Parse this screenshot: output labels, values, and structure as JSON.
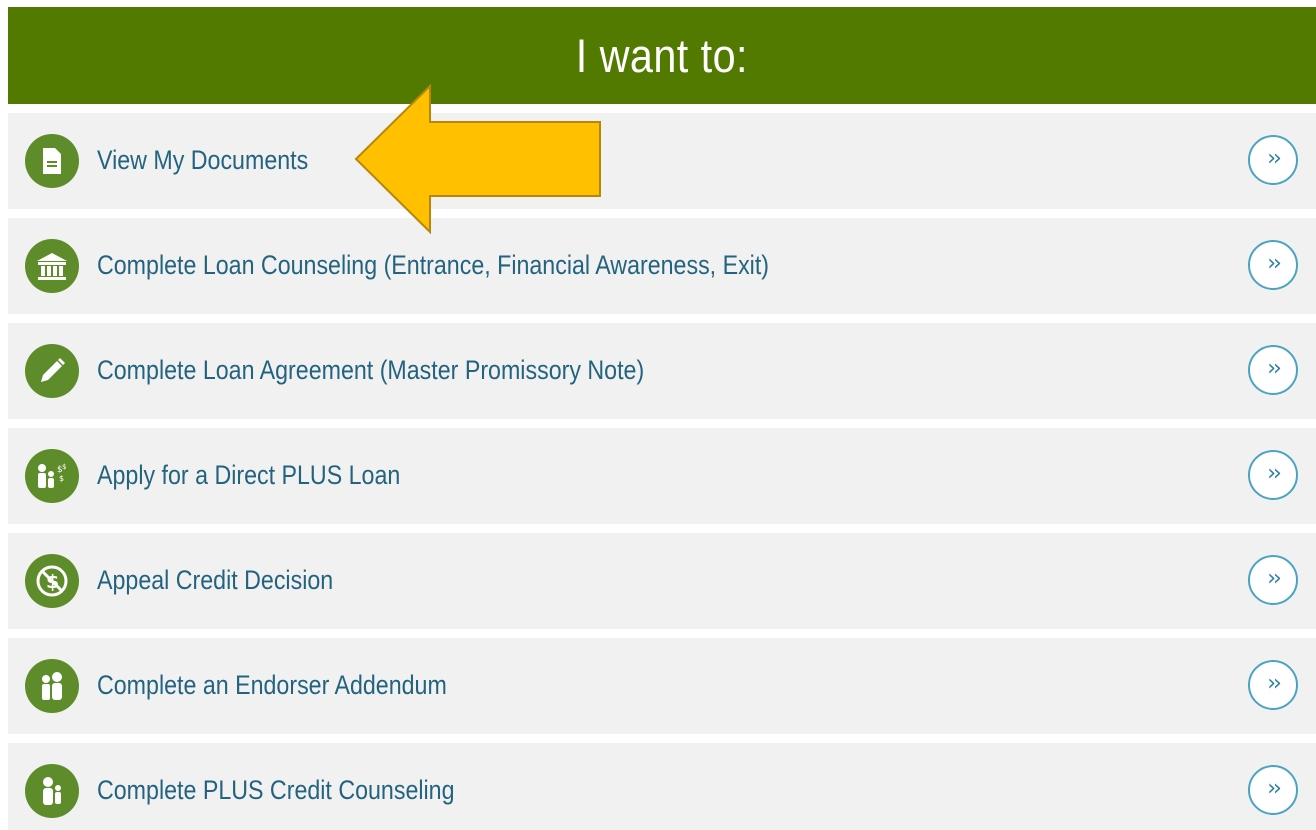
{
  "header": {
    "title": "I want to:"
  },
  "colors": {
    "header_bg": "#527a00",
    "icon_bg": "#5e8c2a",
    "link_text": "#24637f",
    "go_button_border": "#4aa3c2",
    "row_bg": "#f1f1f1",
    "arrow_fill": "#ffc000",
    "arrow_stroke": "#b8860b"
  },
  "menu": {
    "items": [
      {
        "label": "View My Documents",
        "icon": "document-icon"
      },
      {
        "label": "Complete Loan Counseling (Entrance, Financial Awareness, Exit)",
        "icon": "bank-icon"
      },
      {
        "label": "Complete Loan Agreement (Master Promissory Note)",
        "icon": "pencil-icon"
      },
      {
        "label": "Apply for a Direct PLUS Loan",
        "icon": "people-money-icon"
      },
      {
        "label": "Appeal Credit Decision",
        "icon": "no-money-icon"
      },
      {
        "label": "Complete an Endorser Addendum",
        "icon": "endorser-icon"
      },
      {
        "label": "Complete PLUS Credit Counseling",
        "icon": "parent-child-icon"
      }
    ],
    "go_glyph": "››"
  },
  "annotation": {
    "icon": "yellow-arrow-icon",
    "points_to": "View My Documents"
  }
}
